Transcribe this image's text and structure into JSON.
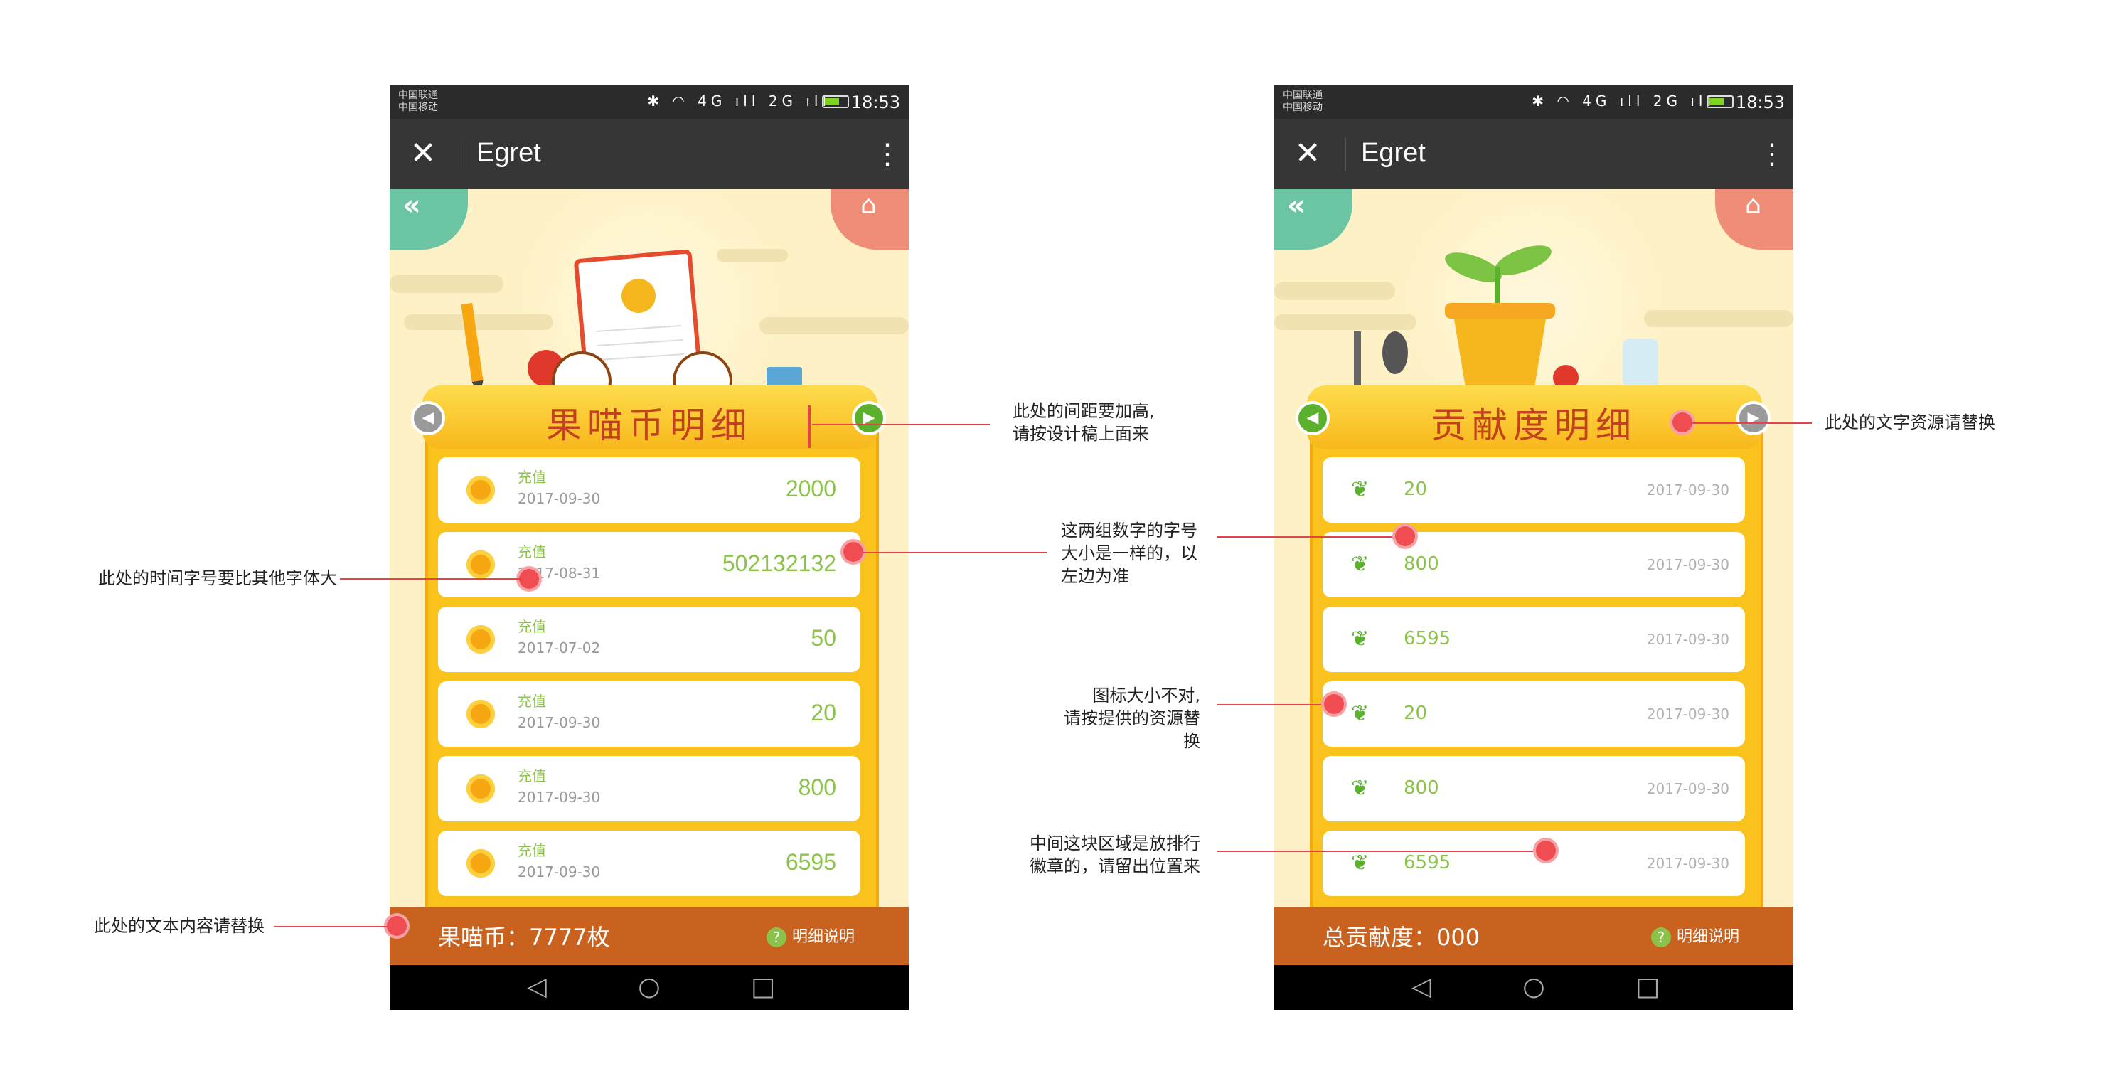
{
  "phone_left": {
    "status": {
      "carrier1": "中国联通",
      "carrier2": "中国移动",
      "icons": "✱ ◠ 4G ıll 2G ıll",
      "time": "18:53"
    },
    "appbar": {
      "title": "Egret",
      "close_glyph": "✕",
      "more_glyph": "⋮"
    },
    "panel_title": "果喵币明细",
    "rows": [
      {
        "type": "充值",
        "date": "2017-09-30",
        "amount": "2000"
      },
      {
        "type": "充值",
        "date": "2017-08-31",
        "amount": "502132132"
      },
      {
        "type": "充值",
        "date": "2017-07-02",
        "amount": "50"
      },
      {
        "type": "充值",
        "date": "2017-09-30",
        "amount": "20"
      },
      {
        "type": "充值",
        "date": "2017-09-30",
        "amount": "800"
      },
      {
        "type": "充值",
        "date": "2017-09-30",
        "amount": "6595"
      }
    ],
    "footer": {
      "text": "果喵币：7777枚",
      "help_label": "明细说明",
      "help_glyph": "?"
    }
  },
  "phone_right": {
    "status": {
      "carrier1": "中国联通",
      "carrier2": "中国移动",
      "icons": "✱ ◠ 4G ıll 2G ıll",
      "time": "18:53"
    },
    "appbar": {
      "title": "Egret",
      "close_glyph": "✕",
      "more_glyph": "⋮"
    },
    "panel_title": "贡献度明细",
    "rows": [
      {
        "value": "20",
        "date": "2017-09-30"
      },
      {
        "value": "800",
        "date": "2017-09-30"
      },
      {
        "value": "6595",
        "date": "2017-09-30"
      },
      {
        "value": "20",
        "date": "2017-09-30"
      },
      {
        "value": "800",
        "date": "2017-09-30"
      },
      {
        "value": "6595",
        "date": "2017-09-30"
      }
    ],
    "footer": {
      "text": "总贡献度：000",
      "help_label": "明细说明",
      "help_glyph": "?"
    }
  },
  "nav": {
    "back": "◁",
    "home": "○",
    "recent": "□"
  },
  "annotations": {
    "spacing_l1": "此处的间距要加高,",
    "spacing_l2": "请按设计稿上面来",
    "time_font": "此处的时间字号要比其他字体大",
    "text_replace": "此处的文本内容请替换",
    "title_res": "此处的文字资源请替换",
    "num_l1": "这两组数字的字号",
    "num_l2": "大小是一样的，以",
    "num_l3": "左边为准",
    "icon_l1": "图标大小不对,",
    "icon_l2": "请按提供的资源替换",
    "badge_l1": "中间这块区域是放排行",
    "badge_l2": "徽章的，请留出位置来"
  }
}
